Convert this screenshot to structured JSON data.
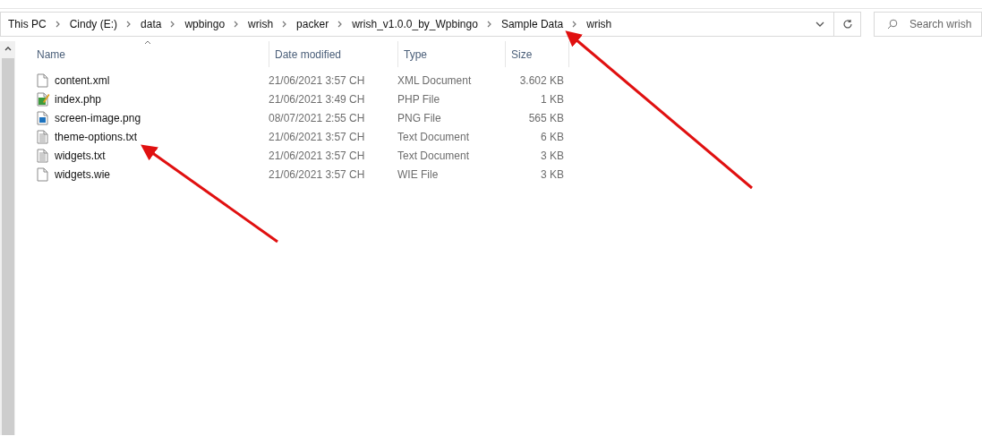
{
  "breadcrumb": [
    "This PC",
    "Cindy (E:)",
    "data",
    "wpbingo",
    "wrish",
    "packer",
    "wrish_v1.0.0_by_Wpbingo",
    "Sample Data",
    "wrish"
  ],
  "search": {
    "placeholder": "Search wrish"
  },
  "columns": [
    "Name",
    "Date modified",
    "Type",
    "Size"
  ],
  "files": [
    {
      "kind": "blank",
      "name": "content.xml",
      "date": "21/06/2021 3:57 CH",
      "type": "XML Document",
      "size": "3.602 KB"
    },
    {
      "kind": "php",
      "name": "index.php",
      "date": "21/06/2021 3:49 CH",
      "type": "PHP File",
      "size": "1 KB"
    },
    {
      "kind": "image",
      "name": "screen-image.png",
      "date": "08/07/2021 2:55 CH",
      "type": "PNG File",
      "size": "565 KB"
    },
    {
      "kind": "text",
      "name": "theme-options.txt",
      "date": "21/06/2021 3:57 CH",
      "type": "Text Document",
      "size": "6 KB"
    },
    {
      "kind": "text",
      "name": "widgets.txt",
      "date": "21/06/2021 3:57 CH",
      "type": "Text Document",
      "size": "3 KB"
    },
    {
      "kind": "blank",
      "name": "widgets.wie",
      "date": "21/06/2021 3:57 CH",
      "type": "WIE File",
      "size": "3 KB"
    }
  ]
}
